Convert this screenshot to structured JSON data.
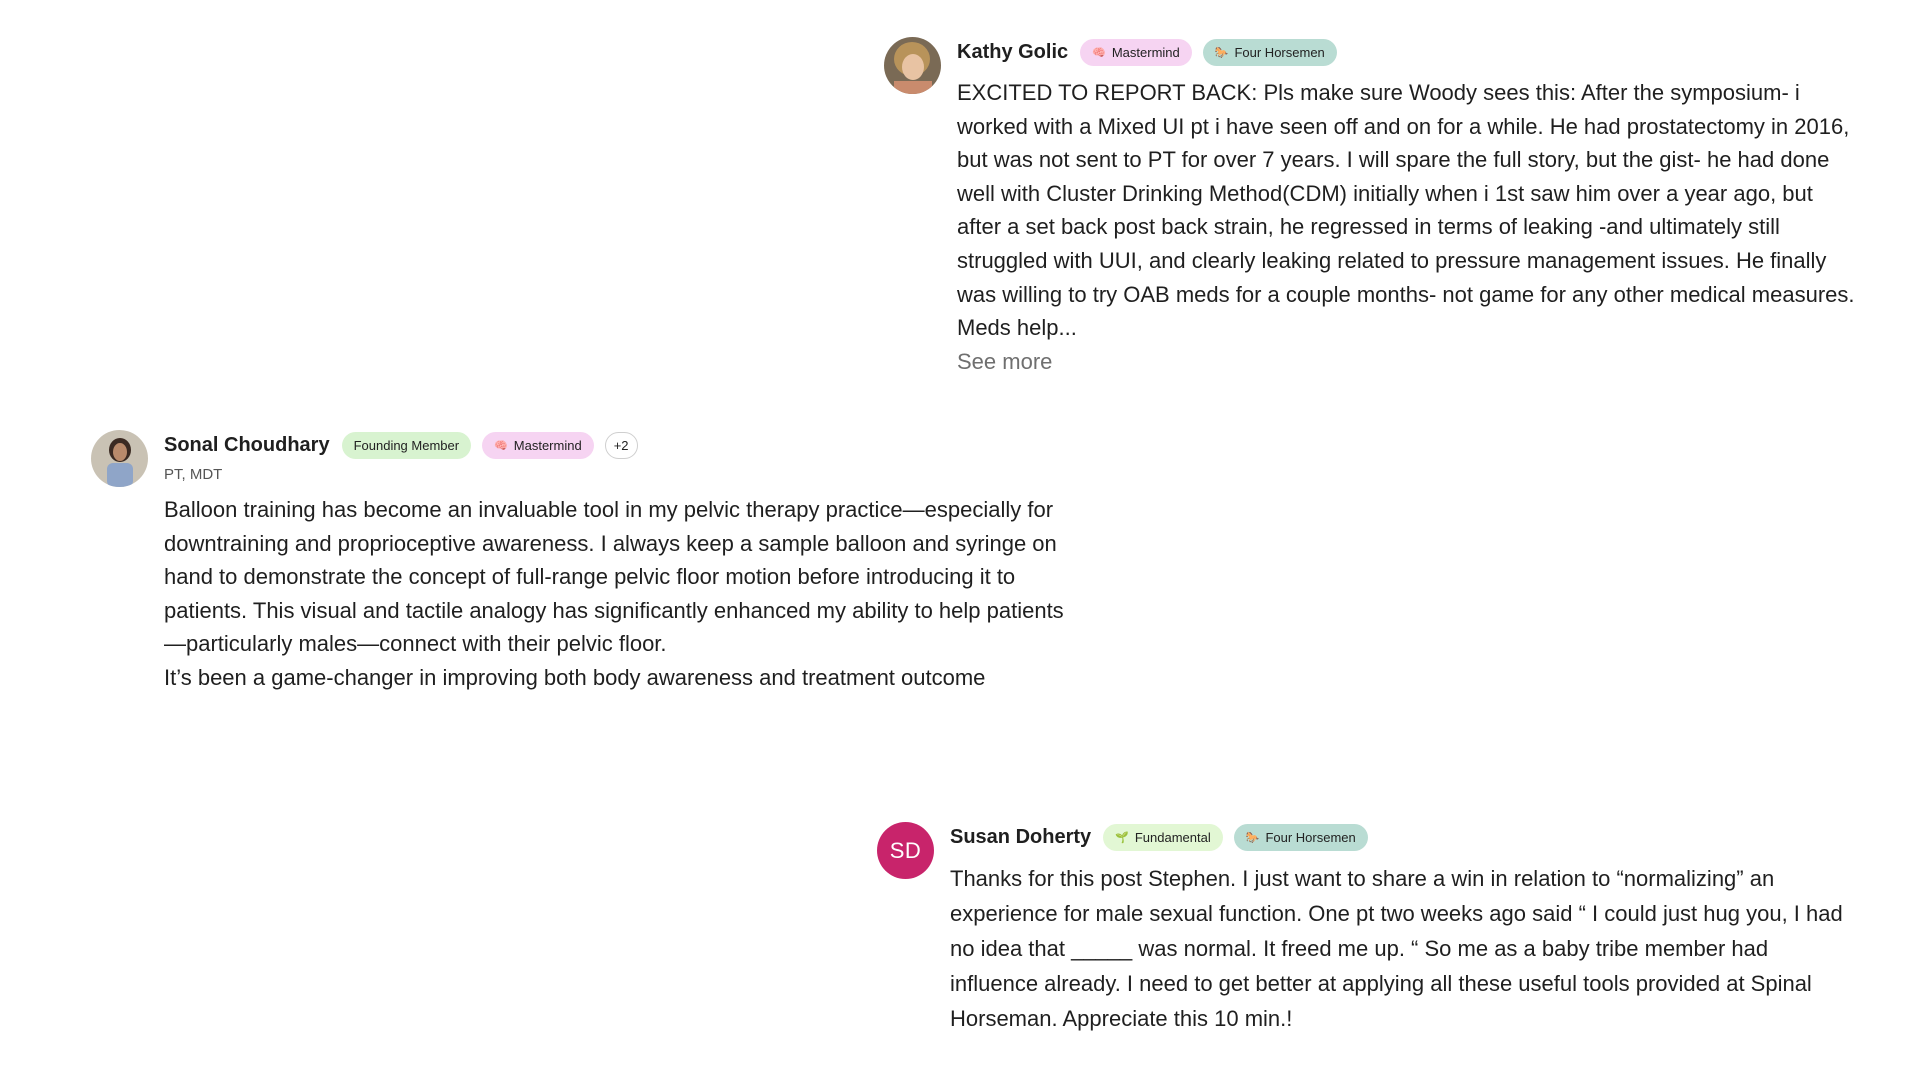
{
  "posts": [
    {
      "author": "Kathy Golic",
      "avatar_icon": "user-photo-icon",
      "badges": [
        {
          "label": "Mastermind",
          "icon": "brain-icon",
          "color": "#f6d4f2"
        },
        {
          "label": "Four Horsemen",
          "icon": "horse-icon",
          "color": "#b9dcd3"
        }
      ],
      "body": "EXCITED TO REPORT BACK:  Pls make sure Woody sees this:  After the symposium- i worked with a Mixed UI pt i have seen off and on for a while.  He had prostatectomy in 2016, but was not sent to PT for over 7 years.  I will spare the full story, but the gist- he had done well with Cluster Drinking Method(CDM) initially when i 1st saw him over a year ago, but after a set back post back strain, he regressed in terms of leaking -and ultimately still struggled with UUI, and clearly leaking related to pressure management issues.  He finally was willing to try OAB meds  for a couple months- not game for any other medical measures. Meds help...",
      "see_more": "See more"
    },
    {
      "author": "Sonal Choudhary",
      "avatar_icon": "user-photo-icon",
      "badges": [
        {
          "label": "Founding Member",
          "icon": "",
          "color": "#d8f3d0"
        },
        {
          "label": "Mastermind",
          "icon": "brain-icon",
          "color": "#f6d4f2"
        }
      ],
      "more_badges": "+2",
      "subtitle": "PT, MDT",
      "body_paragraphs": [
        "Balloon training has become an invaluable tool in my pelvic therapy practice—especially for downtraining and proprioceptive awareness. I always keep a sample balloon and syringe on hand to demonstrate the concept of full-range pelvic floor motion before introducing it to patients. This visual and tactile analogy has significantly enhanced my ability to help patients—particularly males—connect with their pelvic floor.",
        "It’s been a game-changer in improving both body awareness and treatment outcome"
      ]
    },
    {
      "author": "Susan Doherty",
      "initials": "SD",
      "avatar_color": "#c8246b",
      "badges": [
        {
          "label": "Fundamental",
          "icon": "seedling-icon",
          "color": "#e2f7d4"
        },
        {
          "label": "Four Horsemen",
          "icon": "horse-icon",
          "color": "#b9dcd3"
        }
      ],
      "body": "Thanks for this post Stephen. I just want to share a win in relation to “normalizing” an experience for male sexual function. One pt two weeks ago said “ I could just hug you, I had no idea that _____ was normal. It freed me up. “ So me as a baby tribe member had influence already. I need to get better at applying all these useful tools provided at Spinal Horseman. Appreciate this 10 min.!"
    }
  ]
}
